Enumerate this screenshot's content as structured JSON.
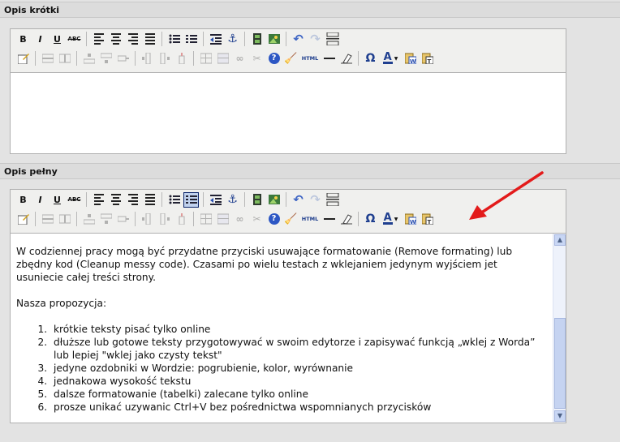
{
  "sections": {
    "short": {
      "title": "Opis krótki"
    },
    "full": {
      "title": "Opis pełny"
    }
  },
  "toolbar": {
    "bold": "B",
    "italic": "I",
    "underline": "U",
    "strike": "ABC",
    "html": "HTML",
    "omega": "Ω",
    "font_color": "A",
    "help": "?"
  },
  "editor_full": {
    "paragraph": "W codziennej pracy mogą być przydatne przyciski usuwające formatowanie (Remove formating) lub zbędny kod (Cleanup messy code). Czasami po wielu testach z wklejaniem jedynym wyjściem jet usuniecie całej treści strony.",
    "proposal_heading": "Nasza propozycja:",
    "list": [
      "krótkie teksty pisać tylko online",
      "dłuższe lub gotowe teksty przygotowywać w swoim edytorze i zapisywać funkcją „wklej z Worda” lub lepiej \"wklej jako czysty tekst\"",
      "jedyne ozdobniki w Wordzie: pogrubienie, kolor, wyrównanie",
      "jednakowa wysokość tekstu",
      "dalsze formatowanie (tabelki) zalecane tylko online",
      "prosze unikać uzywanic Ctrl+V bez pośrednictwa wspomnianych przycisków"
    ]
  },
  "colors": {
    "annotation_arrow": "#e31b1b",
    "toolbar_bg": "#f0f0ee",
    "active_button_bg": "#c1d2ee"
  }
}
